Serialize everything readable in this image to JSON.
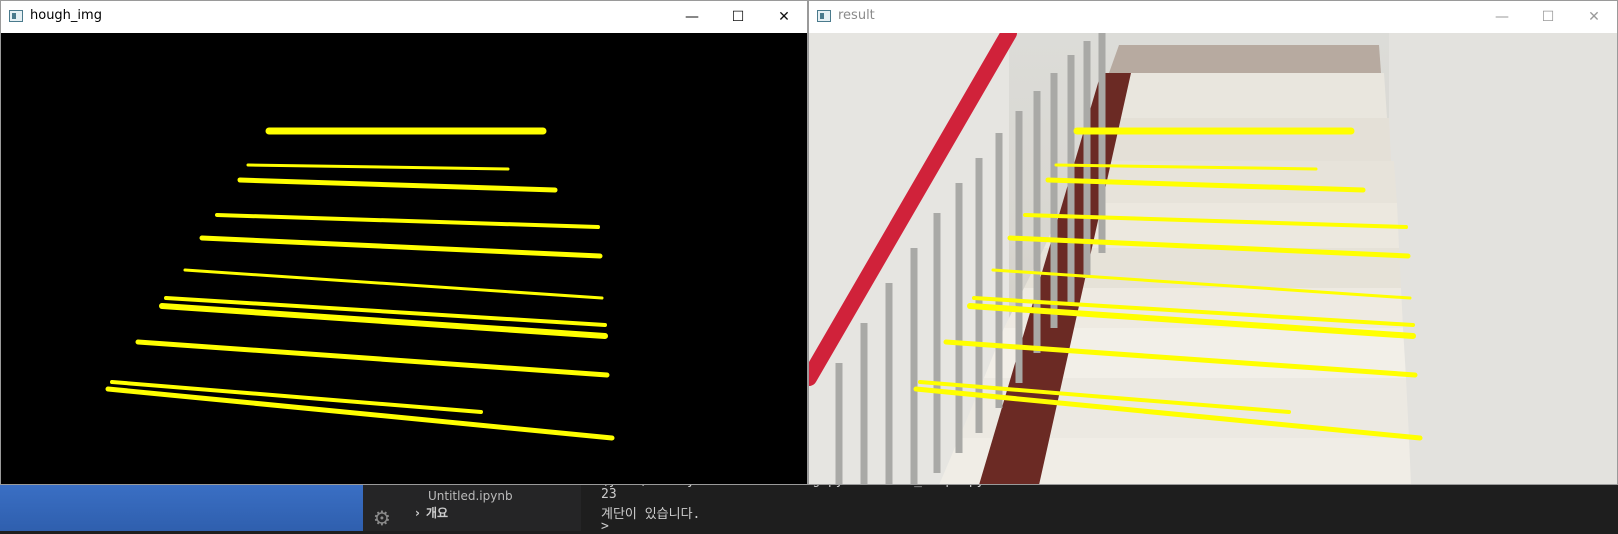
{
  "windows": {
    "hough": {
      "title": "hough_img"
    },
    "result": {
      "title": "result"
    }
  },
  "controls": {
    "minimize": "—",
    "maximize": "☐",
    "close": "✕"
  },
  "vscode": {
    "file_item": "Untitled.ipynb",
    "section": "개요",
    "terminal_lines": [
      "(yolo) E:\\Python\\SelfDriving\\python line_slope.py",
      "23",
      "계단이 있습니다.",
      ">"
    ]
  },
  "colors": {
    "line_yellow": "#ffff00",
    "handrail_red": "#d0223a",
    "window_bg": "#ffffff"
  },
  "icons": [
    "window-app-icon",
    "minimize-icon",
    "maximize-icon",
    "close-icon",
    "gear-icon",
    "chevron-right-icon"
  ]
}
